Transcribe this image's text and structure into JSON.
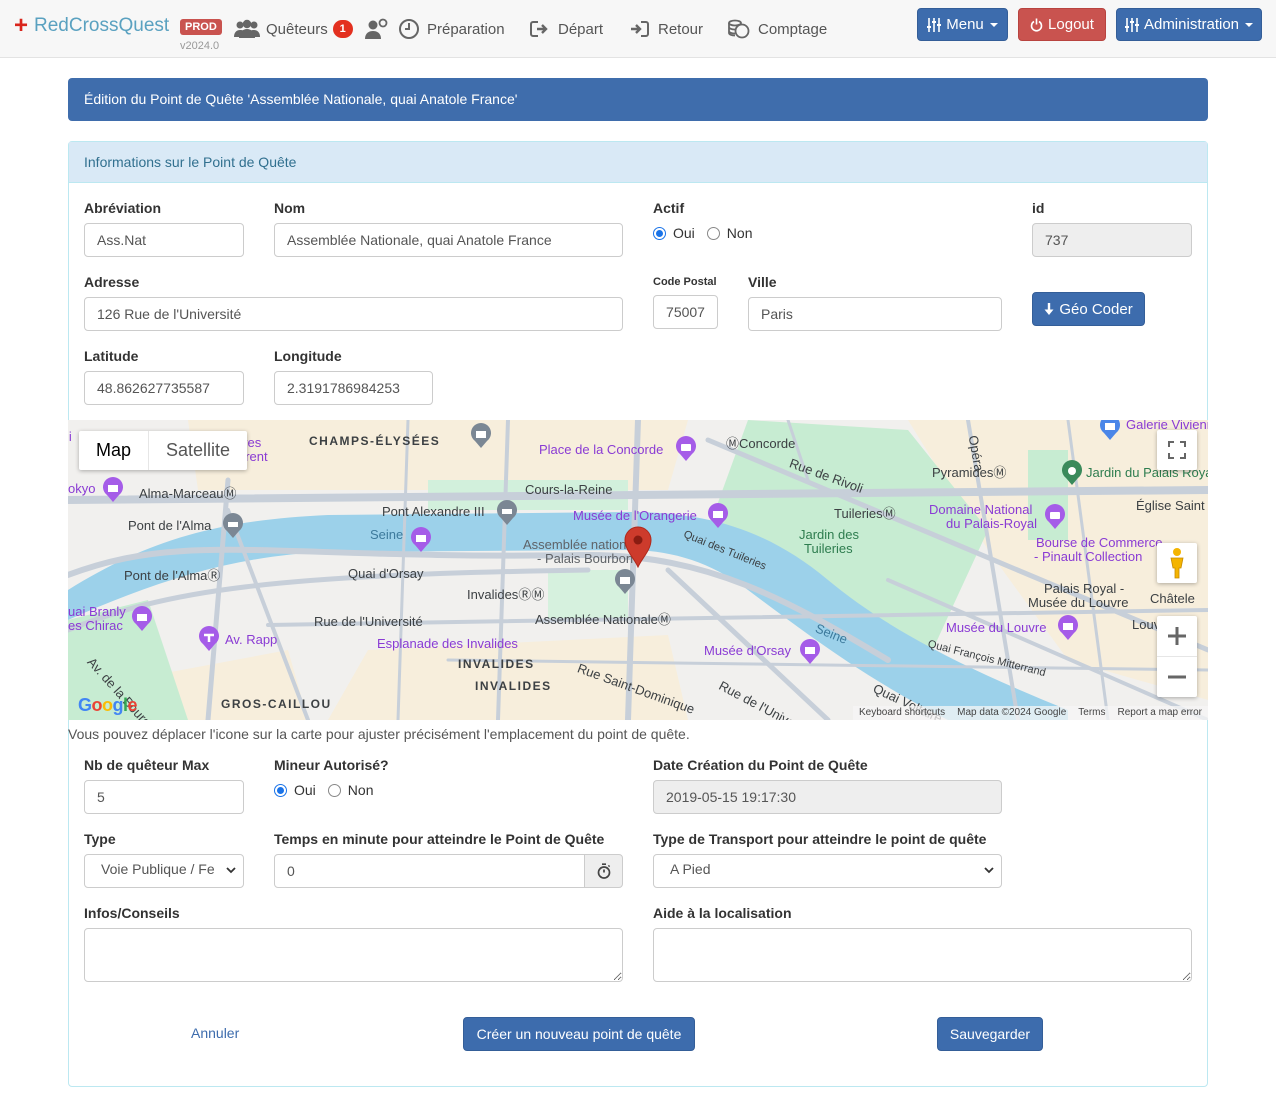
{
  "navbar": {
    "brand": "RedCrossQuest",
    "env_badge": "PROD",
    "version": "v2024.0",
    "items": [
      {
        "label": "Quêteurs",
        "icon": "users-icon",
        "badge": "1"
      },
      {
        "label": "",
        "icon": "add-user-icon"
      },
      {
        "label": "Préparation",
        "icon": "clock-icon"
      },
      {
        "label": "Départ",
        "icon": "sign-out-icon"
      },
      {
        "label": "Retour",
        "icon": "sign-in-icon"
      },
      {
        "label": "Comptage",
        "icon": "coins-icon"
      }
    ],
    "menu_label": "Menu",
    "logout_label": "Logout",
    "admin_label": "Administration",
    "colors": {
      "primary": "#3d6cad",
      "danger": "#c9534f",
      "brand_cross": "#d9251c",
      "brand_text": "#5aa1c0"
    }
  },
  "page": {
    "title": "Édition du Point de Quête 'Assemblée Nationale, quai Anatole France'",
    "panel_title": "Informations sur le Point de Quête"
  },
  "form": {
    "abbreviation": {
      "label": "Abréviation",
      "value": "Ass.Nat"
    },
    "name": {
      "label": "Nom",
      "value": "Assemblée Nationale, quai Anatole France"
    },
    "active": {
      "label": "Actif",
      "options": [
        "Oui",
        "Non"
      ],
      "selected": "Oui"
    },
    "id": {
      "label": "id",
      "value": "737"
    },
    "address": {
      "label": "Adresse",
      "value": "126 Rue de l'Université"
    },
    "postal_code": {
      "label": "Code Postal",
      "value": "75007"
    },
    "city": {
      "label": "Ville",
      "value": "Paris"
    },
    "geocode_label": "Géo Coder",
    "latitude": {
      "label": "Latitude",
      "value": "48.862627735587"
    },
    "longitude": {
      "label": "Longitude",
      "value": "2.3191786984253"
    },
    "map_help": "Vous pouvez déplacer l'icone sur la carte pour ajuster précisément l'emplacement du point de quête.",
    "max_queteurs": {
      "label": "Nb de quêteur Max",
      "value": "5"
    },
    "minor_allowed": {
      "label": "Mineur Autorisé?",
      "options": [
        "Oui",
        "Non"
      ],
      "selected": "Oui"
    },
    "creation_date": {
      "label": "Date Création du Point de Quête",
      "value": "2019-05-15 19:17:30"
    },
    "type": {
      "label": "Type",
      "value": "Voie Publique / Fe"
    },
    "travel_time": {
      "label": "Temps en minute pour atteindre le Point de Quête",
      "value": "0"
    },
    "transport_type": {
      "label": "Type de Transport pour atteindre le point de quête",
      "value": "A Pied"
    },
    "advice": {
      "label": "Infos/Conseils",
      "value": ""
    },
    "location_help": {
      "label": "Aide à la localisation",
      "value": ""
    },
    "cancel_label": "Annuler",
    "create_label": "Créer un nouveau point de quête",
    "save_label": "Sauvegarder"
  },
  "map": {
    "type_options": [
      "Map",
      "Satellite"
    ],
    "selected_type": "Map",
    "google_logo": "Google",
    "footer": [
      "Keyboard shortcuts",
      "Map data ©2024 Google",
      "Terms",
      "Report a map error"
    ],
    "labels": {
      "champs": "CHAMPS-ÉLYSÉES",
      "concorde_place": "Place de la Concorde",
      "concorde_metro": "Concorde",
      "rivoli": "Rue de Rivoli",
      "pyramides": "Pyramides",
      "opera": "Opéra",
      "galerie": "Galerie Vivienne",
      "jardin_palais": "Jardin du Palais Royal",
      "eglise": "Église Saint",
      "alma_marceau": "Alma-Marceau",
      "cours_reine": "Cours-la-Reine",
      "tokyo": "okyo",
      "yves": "ves",
      "laurent": "urent",
      "pont_alma": "Pont de l'Alma",
      "pont_alex": "Pont Alexandre III",
      "seine1": "Seine",
      "orangerie": "Musée de l'Orangerie",
      "tuileries_metro": "Tuileries",
      "domaine": "Domaine National",
      "domaine2": "du Palais-Royal",
      "jardin_tuileries": "Jardin des",
      "jardin_tuileries2": "Tuileries",
      "bourse": "Bourse de Commerce",
      "bourse2": "- Pinault Collection",
      "assemblee": "Assemblée nationale",
      "assemblee2": "- Palais Bourbon",
      "quai_tuileries": "Quai des Tuileries",
      "pont_alma_rer": "Pont de l'Alma",
      "quai_orsay": "Quai d'Orsay",
      "palais_royal": "Palais Royal -",
      "palais_royal2": "Musée du Louvre",
      "chatelet": "Châtele",
      "invalides_metro": "Invalides",
      "quai_branly": "uai Branly",
      "chirac": "es Chirac",
      "rue_universite": "Rue de l'Université",
      "assemblee_metro": "Assemblée Nationale",
      "seine2": "Seine",
      "louvre": "Musée du Louvre",
      "louvre_metro": "Louv",
      "av_rapp": "Av. Rapp",
      "esplanade": "Esplanade des Invalides",
      "invalides1": "INVALIDES",
      "invalides2": "INVALIDES",
      "saint_dominique": "Rue Saint-Dominique",
      "orsay": "Musée d'Orsay",
      "rue_univ2": "Rue de l'Université",
      "quai_mitterrand": "Quai François Mitterrand",
      "bourdonnais": "Av. de la Bourdonnais",
      "gros_caillou": "GROS-CAILLOU",
      "quai_voltaire": "Quai Voltaire"
    },
    "colors": {
      "water": "#9cd1ea",
      "park": "#c6ecd0",
      "road": "#c7cfd9",
      "urban": "#f8efdc",
      "poi": "#8a3bd4",
      "pin": "#cd3b2c"
    }
  }
}
